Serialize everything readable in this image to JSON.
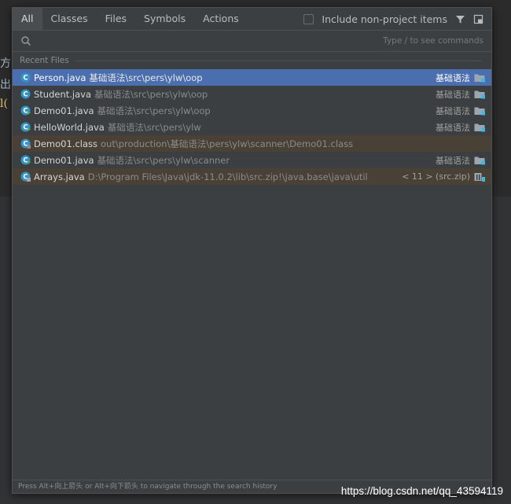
{
  "tabs": [
    {
      "label": "All",
      "active": true
    },
    {
      "label": "Classes",
      "active": false
    },
    {
      "label": "Files",
      "active": false
    },
    {
      "label": "Symbols",
      "active": false
    },
    {
      "label": "Actions",
      "active": false
    }
  ],
  "include_non_project_label": "Include non-project items",
  "search": {
    "value": "",
    "placeholder": "",
    "hint": "Type / to see commands"
  },
  "section_title": "Recent Files",
  "files": [
    {
      "name": "Person.java",
      "path": "基础语法\\src\\pers\\ylw\\oop",
      "module": "基础语法",
      "state": "selected",
      "icon": "java-class-icon"
    },
    {
      "name": "Student.java",
      "path": "基础语法\\src\\pers\\ylw\\oop",
      "module": "基础语法",
      "state": "normal",
      "icon": "java-class-icon"
    },
    {
      "name": "Demo01.java",
      "path": "基础语法\\src\\pers\\ylw\\oop",
      "module": "基础语法",
      "state": "normal",
      "icon": "java-runnable-class-icon"
    },
    {
      "name": "HelloWorld.java",
      "path": "基础语法\\src\\pers\\ylw",
      "module": "基础语法",
      "state": "normal",
      "icon": "java-runnable-class-icon"
    },
    {
      "name": "Demo01.class",
      "path": "out\\production\\基础语法\\pers\\ylw\\scanner\\Demo01.class",
      "module": "",
      "state": "excluded",
      "icon": "compiled-class-icon"
    },
    {
      "name": "Demo01.java",
      "path": "基础语法\\src\\pers\\ylw\\scanner",
      "module": "基础语法",
      "state": "normal",
      "icon": "java-runnable-class-icon"
    },
    {
      "name": "Arrays.java",
      "path": "D:\\Program Files\\Java\\jdk-11.0.2\\lib\\src.zip!\\java.base\\java\\util",
      "module": "< 11 > (src.zip)",
      "state": "excluded",
      "icon": "library-class-icon"
    }
  ],
  "footer_hint": "Press Alt+向上箭头 or Alt+向下箭头 to navigate through the search history",
  "watermark": "https://blog.csdn.net/qq_43594119",
  "colors": {
    "selected_row": "#4b6eaf",
    "excluded_row": "#4a4136",
    "popup_bg": "#3c3f41",
    "class_icon": "#3592c4"
  }
}
